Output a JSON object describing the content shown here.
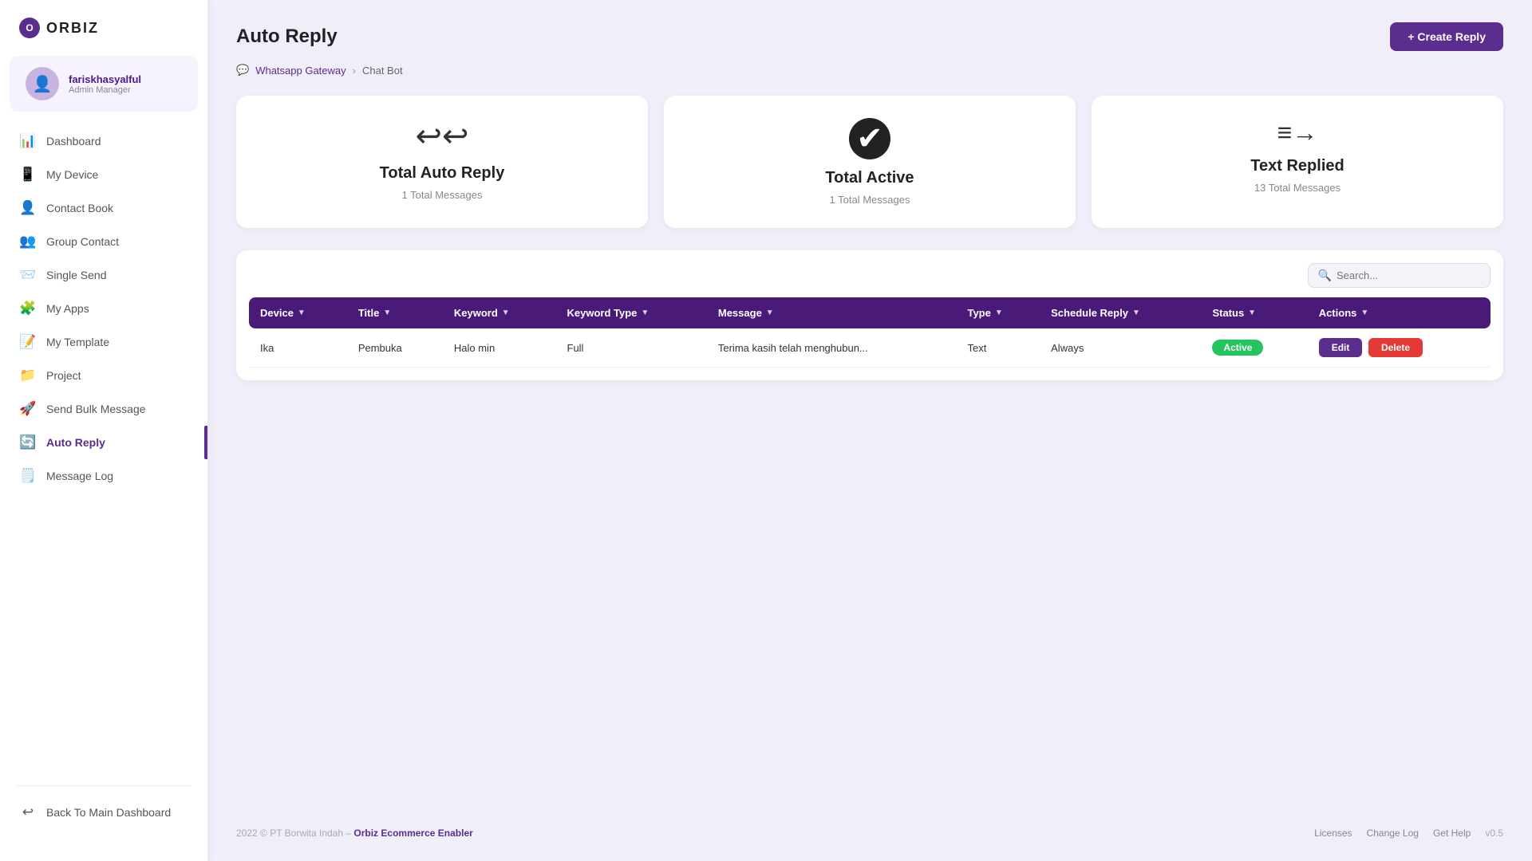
{
  "app": {
    "logo_text": "ORBIZ",
    "logo_symbol": "O"
  },
  "sidebar": {
    "user": {
      "name": "fariskhasyalful",
      "role": "Admin Manager"
    },
    "nav_items": [
      {
        "id": "dashboard",
        "label": "Dashboard",
        "icon": "📊"
      },
      {
        "id": "my-device",
        "label": "My Device",
        "icon": "📱"
      },
      {
        "id": "contact-book",
        "label": "Contact Book",
        "icon": "👤"
      },
      {
        "id": "group-contact",
        "label": "Group Contact",
        "icon": "👥"
      },
      {
        "id": "single-send",
        "label": "Single Send",
        "icon": "📨"
      },
      {
        "id": "my-apps",
        "label": "My Apps",
        "icon": "🧩"
      },
      {
        "id": "my-template",
        "label": "My Template",
        "icon": "📝"
      },
      {
        "id": "project",
        "label": "Project",
        "icon": "📁"
      },
      {
        "id": "send-bulk-message",
        "label": "Send Bulk Message",
        "icon": "🚀"
      },
      {
        "id": "auto-reply",
        "label": "Auto Reply",
        "icon": "🔄",
        "active": true
      },
      {
        "id": "message-log",
        "label": "Message Log",
        "icon": "🗒️"
      }
    ],
    "back_label": "Back To Main Dashboard"
  },
  "header": {
    "page_title": "Auto Reply",
    "breadcrumb_parent": "Whatsapp Gateway",
    "breadcrumb_child": "Chat Bot",
    "create_btn_label": "+ Create Reply"
  },
  "stats": [
    {
      "id": "total-auto-reply",
      "icon_char": "↩",
      "icon_name": "auto-reply-icon",
      "title": "Total Auto Reply",
      "sub": "1 Total Messages"
    },
    {
      "id": "total-active",
      "icon_char": "✔",
      "icon_name": "active-check-icon",
      "title": "Total Active",
      "sub": "1 Total Messages"
    },
    {
      "id": "text-replied",
      "icon_char": "≡→",
      "icon_name": "text-replied-icon",
      "title": "Text Replied",
      "sub": "13 Total Messages"
    }
  ],
  "table": {
    "search_placeholder": "Search...",
    "columns": [
      "Device",
      "Title",
      "Keyword",
      "Keyword Type",
      "Message",
      "Type",
      "Schedule Reply",
      "Status",
      "Actions"
    ],
    "rows": [
      {
        "device": "Ika",
        "title": "Pembuka",
        "keyword": "Halo min",
        "keyword_type": "Full",
        "message": "Terima kasih telah menghubun...",
        "type": "Text",
        "schedule_reply": "Always",
        "status": "Active",
        "edit_label": "Edit",
        "delete_label": "Delete"
      }
    ]
  },
  "footer": {
    "left_text": "2022 © PT Borwita Indah –",
    "left_link_label": "Orbiz Ecommerce Enabler",
    "links": [
      "Licenses",
      "Change Log",
      "Get Help"
    ],
    "version": "v0.5"
  }
}
